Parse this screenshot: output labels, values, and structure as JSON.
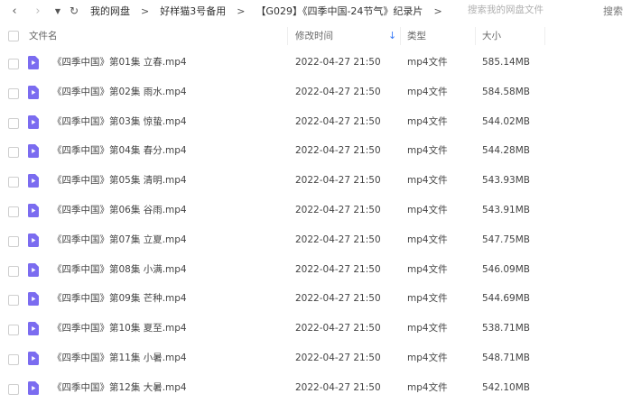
{
  "nav": {
    "back_icon": "‹",
    "forward_icon": "›",
    "dropdown_icon": "▼",
    "refresh_icon": "↻"
  },
  "breadcrumb": {
    "items": [
      "我的网盘",
      "好样猫3号备用",
      "【G029】《四季中国-24节气》纪录片"
    ],
    "separator": ">"
  },
  "search": {
    "placeholder": "搜索我的网盘文件",
    "button_label": "搜索"
  },
  "columns": {
    "name": "文件名",
    "modified": "修改时间",
    "type": "类型",
    "size": "大小"
  },
  "sort_icon": "↓",
  "colors": {
    "icon_purple": "#7b6cf0",
    "accent_blue": "#3b7bf6"
  },
  "files": [
    {
      "name": "《四季中国》第01集 立春.mp4",
      "modified": "2022-04-27 21:50",
      "type": "mp4文件",
      "size": "585.14MB"
    },
    {
      "name": "《四季中国》第02集 雨水.mp4",
      "modified": "2022-04-27 21:50",
      "type": "mp4文件",
      "size": "584.58MB"
    },
    {
      "name": "《四季中国》第03集 惊蛰.mp4",
      "modified": "2022-04-27 21:50",
      "type": "mp4文件",
      "size": "544.02MB"
    },
    {
      "name": "《四季中国》第04集 春分.mp4",
      "modified": "2022-04-27 21:50",
      "type": "mp4文件",
      "size": "544.28MB"
    },
    {
      "name": "《四季中国》第05集 清明.mp4",
      "modified": "2022-04-27 21:50",
      "type": "mp4文件",
      "size": "543.93MB"
    },
    {
      "name": "《四季中国》第06集 谷雨.mp4",
      "modified": "2022-04-27 21:50",
      "type": "mp4文件",
      "size": "543.91MB"
    },
    {
      "name": "《四季中国》第07集 立夏.mp4",
      "modified": "2022-04-27 21:50",
      "type": "mp4文件",
      "size": "547.75MB"
    },
    {
      "name": "《四季中国》第08集 小满.mp4",
      "modified": "2022-04-27 21:50",
      "type": "mp4文件",
      "size": "546.09MB"
    },
    {
      "name": "《四季中国》第09集 芒种.mp4",
      "modified": "2022-04-27 21:50",
      "type": "mp4文件",
      "size": "544.69MB"
    },
    {
      "name": "《四季中国》第10集 夏至.mp4",
      "modified": "2022-04-27 21:50",
      "type": "mp4文件",
      "size": "538.71MB"
    },
    {
      "name": "《四季中国》第11集  小暑.mp4",
      "modified": "2022-04-27 21:50",
      "type": "mp4文件",
      "size": "548.71MB"
    },
    {
      "name": "《四季中国》第12集 大暑.mp4",
      "modified": "2022-04-27 21:50",
      "type": "mp4文件",
      "size": "542.10MB"
    }
  ]
}
